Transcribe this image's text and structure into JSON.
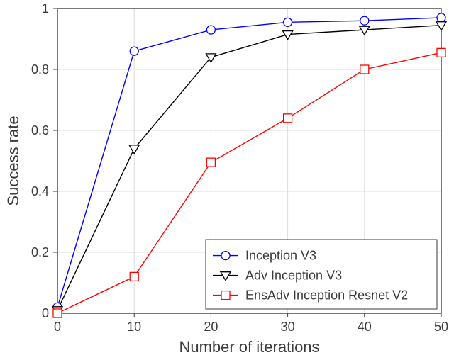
{
  "chart_data": {
    "type": "line",
    "title": "",
    "xlabel": "Number of iterations",
    "ylabel": "Success rate",
    "xlim": [
      0,
      50
    ],
    "ylim": [
      0,
      1
    ],
    "xticks": [
      0,
      10,
      20,
      30,
      40,
      50
    ],
    "yticks": [
      0,
      0.2,
      0.4,
      0.6,
      0.8,
      1
    ],
    "grid": true,
    "legend_position": "bottom-right",
    "x": [
      0,
      10,
      20,
      30,
      40,
      50
    ],
    "series": [
      {
        "name": "Inception V3",
        "color": "#0000ff",
        "marker": "circle",
        "values": [
          0.02,
          0.86,
          0.93,
          0.955,
          0.96,
          0.97
        ]
      },
      {
        "name": "Adv Inception V3",
        "color": "#000000",
        "marker": "triangle-down",
        "values": [
          0.01,
          0.54,
          0.84,
          0.915,
          0.93,
          0.945
        ]
      },
      {
        "name": "EnsAdv Inception Resnet V2",
        "color": "#ff0000",
        "marker": "square",
        "values": [
          0.0,
          0.12,
          0.495,
          0.64,
          0.8,
          0.855
        ]
      }
    ]
  }
}
